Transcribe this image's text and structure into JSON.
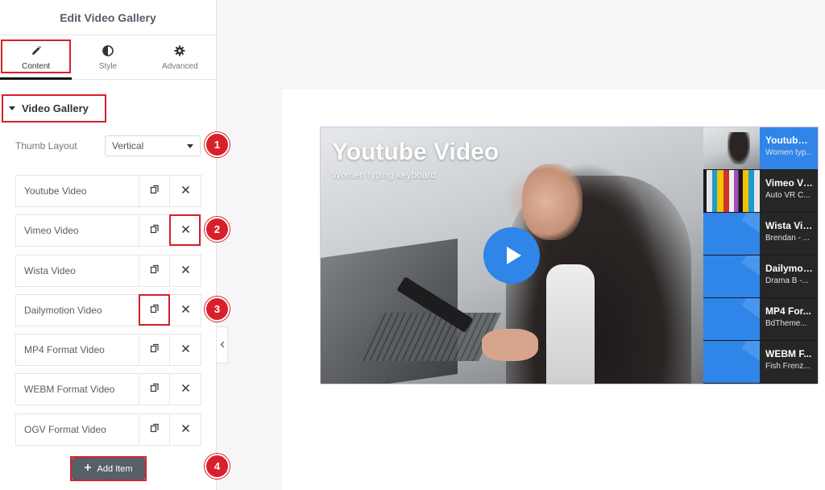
{
  "panel": {
    "title": "Edit Video Gallery",
    "tabs": [
      {
        "label": "Content",
        "icon": "pencil-icon",
        "active": true
      },
      {
        "label": "Style",
        "icon": "contrast-icon",
        "active": false
      },
      {
        "label": "Advanced",
        "icon": "gear-icon",
        "active": false
      }
    ],
    "section_title": "Video Gallery",
    "thumb_layout": {
      "label": "Thumb Layout",
      "value": "Vertical"
    },
    "items": [
      {
        "title": "Youtube Video"
      },
      {
        "title": "Vimeo Video"
      },
      {
        "title": "Wista Video"
      },
      {
        "title": "Dailymotion Video"
      },
      {
        "title": "MP4 Format Video"
      },
      {
        "title": "WEBM Format Video"
      },
      {
        "title": "OGV Format Video"
      }
    ],
    "add_item_label": "Add Item"
  },
  "badges": [
    "1",
    "2",
    "3",
    "4"
  ],
  "preview": {
    "main_video": {
      "title": "Youtube Video",
      "subtitle": "Women typing keyboard"
    },
    "thumbs": [
      {
        "title": "Youtube ...",
        "subtitle": "Women typ..."
      },
      {
        "title": "Vimeo Vi...",
        "subtitle": "Auto VR C..."
      },
      {
        "title": "Wista Vid...",
        "subtitle": "Brendan - ..."
      },
      {
        "title": "Dailymoti...",
        "subtitle": "Drama B -..."
      },
      {
        "title": "MP4 For...",
        "subtitle": "BdTheme..."
      },
      {
        "title": "WEBM F...",
        "subtitle": "Fish Frenz..."
      }
    ]
  },
  "colors": {
    "accent": "#2f85e8",
    "highlight": "#d8202b",
    "button": "#556068"
  }
}
